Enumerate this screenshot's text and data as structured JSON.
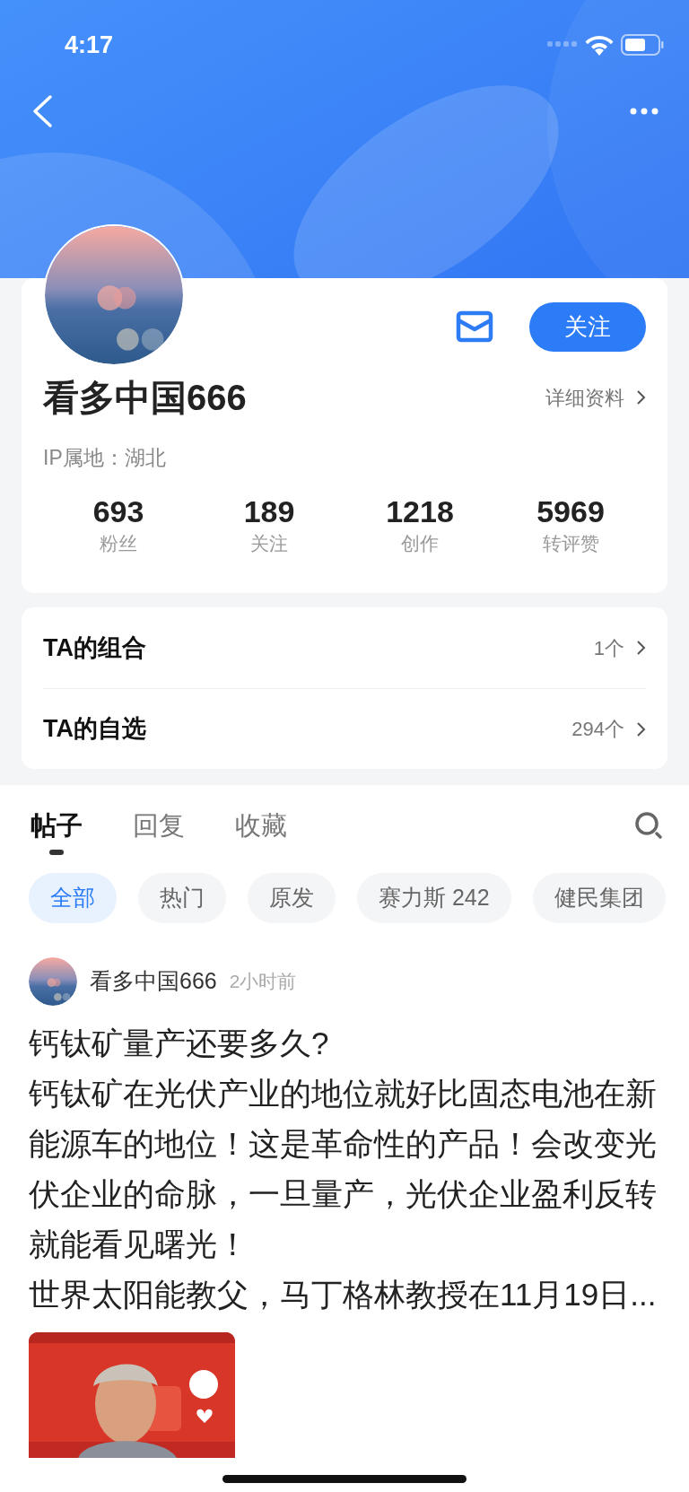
{
  "status_bar": {
    "time": "4:17"
  },
  "profile": {
    "follow_button": "关注",
    "name": "看多中国666",
    "details_link": "详细资料",
    "ip_location": "IP属地：湖北",
    "stats": [
      {
        "value": "693",
        "label": "粉丝"
      },
      {
        "value": "189",
        "label": "关注"
      },
      {
        "value": "1218",
        "label": "创作"
      },
      {
        "value": "5969",
        "label": "转评赞"
      }
    ]
  },
  "links": [
    {
      "label": "TA的组合",
      "count": "1个"
    },
    {
      "label": "TA的自选",
      "count": "294个"
    }
  ],
  "tabs": [
    {
      "label": "帖子",
      "selected": true
    },
    {
      "label": "回复",
      "selected": false
    },
    {
      "label": "收藏",
      "selected": false
    }
  ],
  "chips": [
    {
      "label": "全部",
      "selected": true
    },
    {
      "label": "热门",
      "selected": false
    },
    {
      "label": "原发",
      "selected": false
    },
    {
      "label": "赛力斯 242",
      "selected": false
    },
    {
      "label": "健民集团",
      "selected": false
    }
  ],
  "post": {
    "author": "看多中国666",
    "time": "2小时前",
    "paragraphs": [
      "钙钛矿量产还要多久?",
      "钙钛矿在光伏产业的地位就好比固态电池在新能源车的地位！这是革命性的产品！会改变光伏企业的命脉，一旦量产，光伏企业盈利反转就能看见曙光！",
      "世界太阳能教父，马丁格林教授在11月19日..."
    ],
    "image": {
      "kind": "picture"
    }
  }
}
